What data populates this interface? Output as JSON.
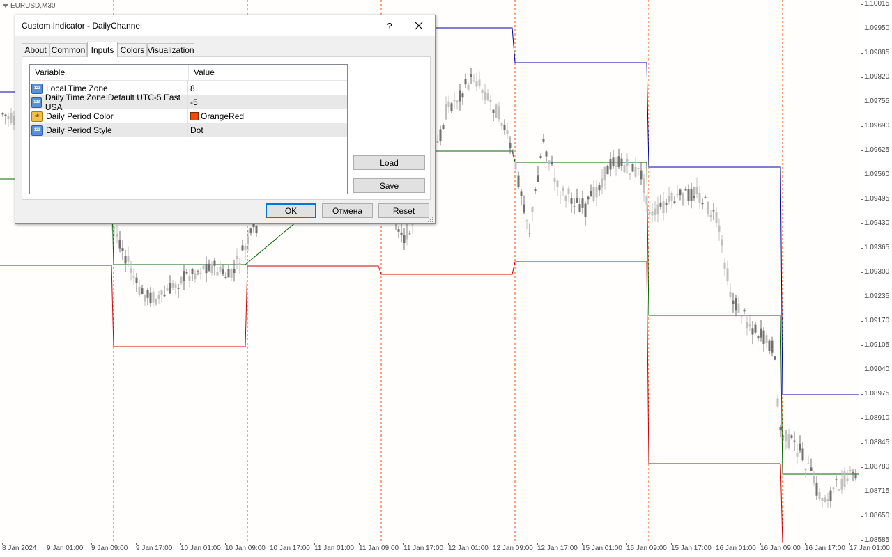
{
  "chart": {
    "symbol": "EURUSD,M30",
    "price_labels": [
      "1.10015",
      "1.09950",
      "1.09885",
      "1.09820",
      "1.09755",
      "1.09690",
      "1.09625",
      "1.09560",
      "1.09495",
      "1.09430",
      "1.09365",
      "1.09300",
      "1.09235",
      "1.09170",
      "1.09105",
      "1.09040",
      "1.08975",
      "1.08910",
      "1.08845",
      "1.08780",
      "1.08715",
      "1.08650",
      "1.08585"
    ],
    "time_labels": [
      "8 Jan 2024",
      "9 Jan 01:00",
      "9 Jan 09:00",
      "9 Jan 17:00",
      "10 Jan 01:00",
      "10 Jan 09:00",
      "10 Jan 17:00",
      "11 Jan 01:00",
      "11 Jan 09:00",
      "11 Jan 17:00",
      "12 Jan 01:00",
      "12 Jan 09:00",
      "12 Jan 17:00",
      "15 Jan 01:00",
      "15 Jan 09:00",
      "15 Jan 17:00",
      "16 Jan 01:00",
      "16 Jan 09:00",
      "16 Jan 17:00",
      "17 Jan 01:00"
    ],
    "colors": {
      "upper_band": "#0000a0",
      "middle_band": "#006400",
      "lower_band": "#cc0000",
      "period_separator": "#ff4500",
      "bull_candle": "#c0c0c0",
      "bear_candle": "#707070"
    }
  },
  "dialog": {
    "title": "Custom Indicator - DailyChannel",
    "help_label": "?",
    "tabs": [
      {
        "label": "About"
      },
      {
        "label": "Common"
      },
      {
        "label": "Inputs"
      },
      {
        "label": "Colors"
      },
      {
        "label": "Visualization"
      }
    ],
    "active_tab": "Inputs",
    "grid": {
      "columns": [
        "Variable",
        "Value"
      ],
      "rows": [
        {
          "icon": "int-icon",
          "variable": "Local Time Zone",
          "value": "8"
        },
        {
          "icon": "int-icon",
          "variable": "Daily Time Zone Default UTC-5 East USA",
          "value": "-5"
        },
        {
          "icon": "color-icon",
          "variable": "Daily Period Color",
          "value": "OrangeRed",
          "swatch": "#ff4500"
        },
        {
          "icon": "int-icon",
          "variable": "Daily Period Style",
          "value": "Dot"
        }
      ]
    },
    "icon_text": {
      "int": "123",
      "color": "clr"
    },
    "buttons": {
      "load": "Load",
      "save": "Save",
      "ok": "OK",
      "cancel": "Отмена",
      "reset": "Reset"
    }
  }
}
